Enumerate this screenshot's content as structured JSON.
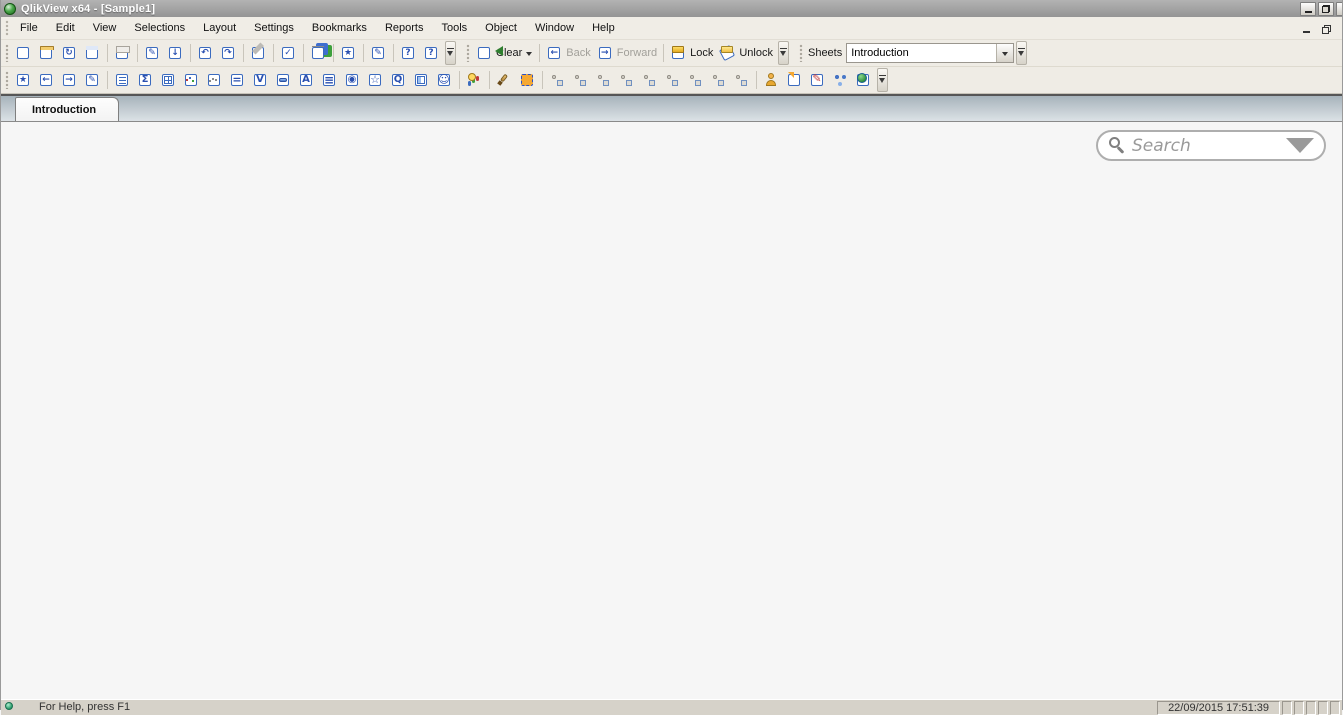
{
  "window": {
    "title": "QlikView x64 - [Sample1]",
    "window_controls": [
      "minimize",
      "restore",
      "close"
    ],
    "document_controls": [
      "minimize-document",
      "restore-document"
    ]
  },
  "menu": {
    "items": [
      "File",
      "Edit",
      "View",
      "Selections",
      "Layout",
      "Settings",
      "Bookmarks",
      "Reports",
      "Tools",
      "Object",
      "Window",
      "Help"
    ]
  },
  "toolbars": {
    "standard": [
      {
        "name": "new-document",
        "icon": "new"
      },
      {
        "name": "open-file",
        "icon": "open"
      },
      {
        "name": "refresh",
        "icon": "refresh",
        "disabled": true
      },
      {
        "name": "save",
        "icon": "save"
      },
      {
        "type": "sep"
      },
      {
        "name": "print",
        "icon": "print",
        "disabled": true
      },
      {
        "type": "sep"
      },
      {
        "name": "edit-script",
        "icon": "edit-script"
      },
      {
        "name": "reload-data",
        "icon": "reload"
      },
      {
        "type": "sep"
      },
      {
        "name": "undo-layout-change",
        "icon": "undo",
        "disabled": true
      },
      {
        "name": "redo-layout-change",
        "icon": "redo",
        "disabled": true
      },
      {
        "type": "sep"
      },
      {
        "name": "search",
        "icon": "find",
        "disabled": true
      },
      {
        "type": "sep"
      },
      {
        "name": "current-selections",
        "icon": "cursel-main"
      },
      {
        "type": "sep"
      },
      {
        "name": "quick-chart-wizard",
        "icon": "quickchart"
      },
      {
        "type": "sep"
      },
      {
        "name": "add-bookmark",
        "icon": "bmk-add"
      },
      {
        "type": "sep"
      },
      {
        "name": "edit-notes",
        "icon": "notes",
        "disabled": true
      },
      {
        "type": "sep"
      },
      {
        "name": "help",
        "icon": "help"
      },
      {
        "name": "context-help",
        "icon": "whatsthis"
      },
      {
        "type": "overflow",
        "name": "standard-toolbar-overflow"
      }
    ],
    "navigation": [
      {
        "name": "clear-selections",
        "icon": "clear",
        "label": "Clear",
        "dropdown": true
      },
      {
        "type": "sep"
      },
      {
        "name": "back",
        "icon": "back",
        "label": "Back",
        "disabled": true
      },
      {
        "name": "forward",
        "icon": "forward",
        "label": "Forward",
        "disabled": true
      },
      {
        "type": "sep"
      },
      {
        "name": "lock-selections",
        "icon": "lock",
        "label": "Lock"
      },
      {
        "name": "unlock-selections",
        "icon": "unlock",
        "label": "Unlock"
      },
      {
        "type": "overflow",
        "name": "navigation-toolbar-overflow"
      }
    ],
    "sheets": {
      "label": "Sheets",
      "selected_sheet": "Introduction"
    },
    "design": [
      {
        "name": "add-sheet",
        "icon": "add-sheet"
      },
      {
        "name": "promote-sheet",
        "icon": "promote",
        "disabled": true
      },
      {
        "name": "demote-sheet",
        "icon": "demote",
        "disabled": true
      },
      {
        "name": "sheet-properties",
        "icon": "sheet-props"
      },
      {
        "type": "sep"
      },
      {
        "name": "create-listbox",
        "icon": "listbox"
      },
      {
        "name": "create-statistics-box",
        "icon": "stats"
      },
      {
        "name": "create-table-box",
        "icon": "tablebox"
      },
      {
        "name": "create-chart",
        "icon": "chart"
      },
      {
        "name": "create-multi-box",
        "icon": "multibox"
      },
      {
        "name": "create-input-box",
        "icon": "input"
      },
      {
        "name": "create-current-selections-box",
        "icon": "curselbox"
      },
      {
        "name": "create-button",
        "icon": "button-obj"
      },
      {
        "name": "create-text-object",
        "icon": "text-obj"
      },
      {
        "name": "create-line-arrow-object",
        "icon": "linearrow"
      },
      {
        "name": "create-slider-object",
        "icon": "slider"
      },
      {
        "name": "create-bookmark-object",
        "icon": "bmk-obj"
      },
      {
        "name": "create-search-object",
        "icon": "search-obj"
      },
      {
        "name": "create-container",
        "icon": "container"
      },
      {
        "name": "create-custom-object",
        "icon": "custom"
      },
      {
        "type": "sep"
      },
      {
        "name": "time-chart-wizard",
        "icon": "chart-time"
      },
      {
        "type": "sep"
      },
      {
        "name": "format-painter",
        "icon": "fmtpainter"
      },
      {
        "name": "design-grid-toggle",
        "icon": "grid"
      },
      {
        "type": "sep"
      },
      {
        "name": "align-left",
        "icon": "align"
      },
      {
        "name": "center-horizontally",
        "icon": "align"
      },
      {
        "name": "align-right",
        "icon": "align"
      },
      {
        "name": "align-bottom",
        "icon": "align"
      },
      {
        "name": "center-vertically",
        "icon": "align"
      },
      {
        "name": "align-top",
        "icon": "align"
      },
      {
        "name": "space-horizontally",
        "icon": "align"
      },
      {
        "name": "space-vertically",
        "icon": "align"
      },
      {
        "name": "adjust-positions",
        "icon": "align"
      },
      {
        "type": "sep"
      },
      {
        "name": "user-preferences",
        "icon": "userpref"
      },
      {
        "name": "document-properties",
        "icon": "docprops"
      },
      {
        "name": "edit-module",
        "icon": "editmodule"
      },
      {
        "name": "expression-overview",
        "icon": "exprov"
      },
      {
        "name": "webview-toggle",
        "icon": "webview"
      },
      {
        "type": "overflow",
        "name": "design-toolbar-overflow"
      }
    ]
  },
  "tabs": [
    {
      "label": "Introduction",
      "active": true
    }
  ],
  "search": {
    "placeholder": "Search"
  },
  "status": {
    "left_text": "For Help, press F1",
    "timestamp": "22/09/2015 17:51:39"
  },
  "colors": {
    "titlebar": "#a3a3a3",
    "toolbar_face": "#efece5",
    "tabstrip_top": "#a7b3bb",
    "tabstrip_bottom": "#dce2e6",
    "content_background": "#f6f6f6",
    "statusbar": "#d6d2c9",
    "accent_blue": "#3b6bbf",
    "accent_green": "#2fa62f"
  }
}
